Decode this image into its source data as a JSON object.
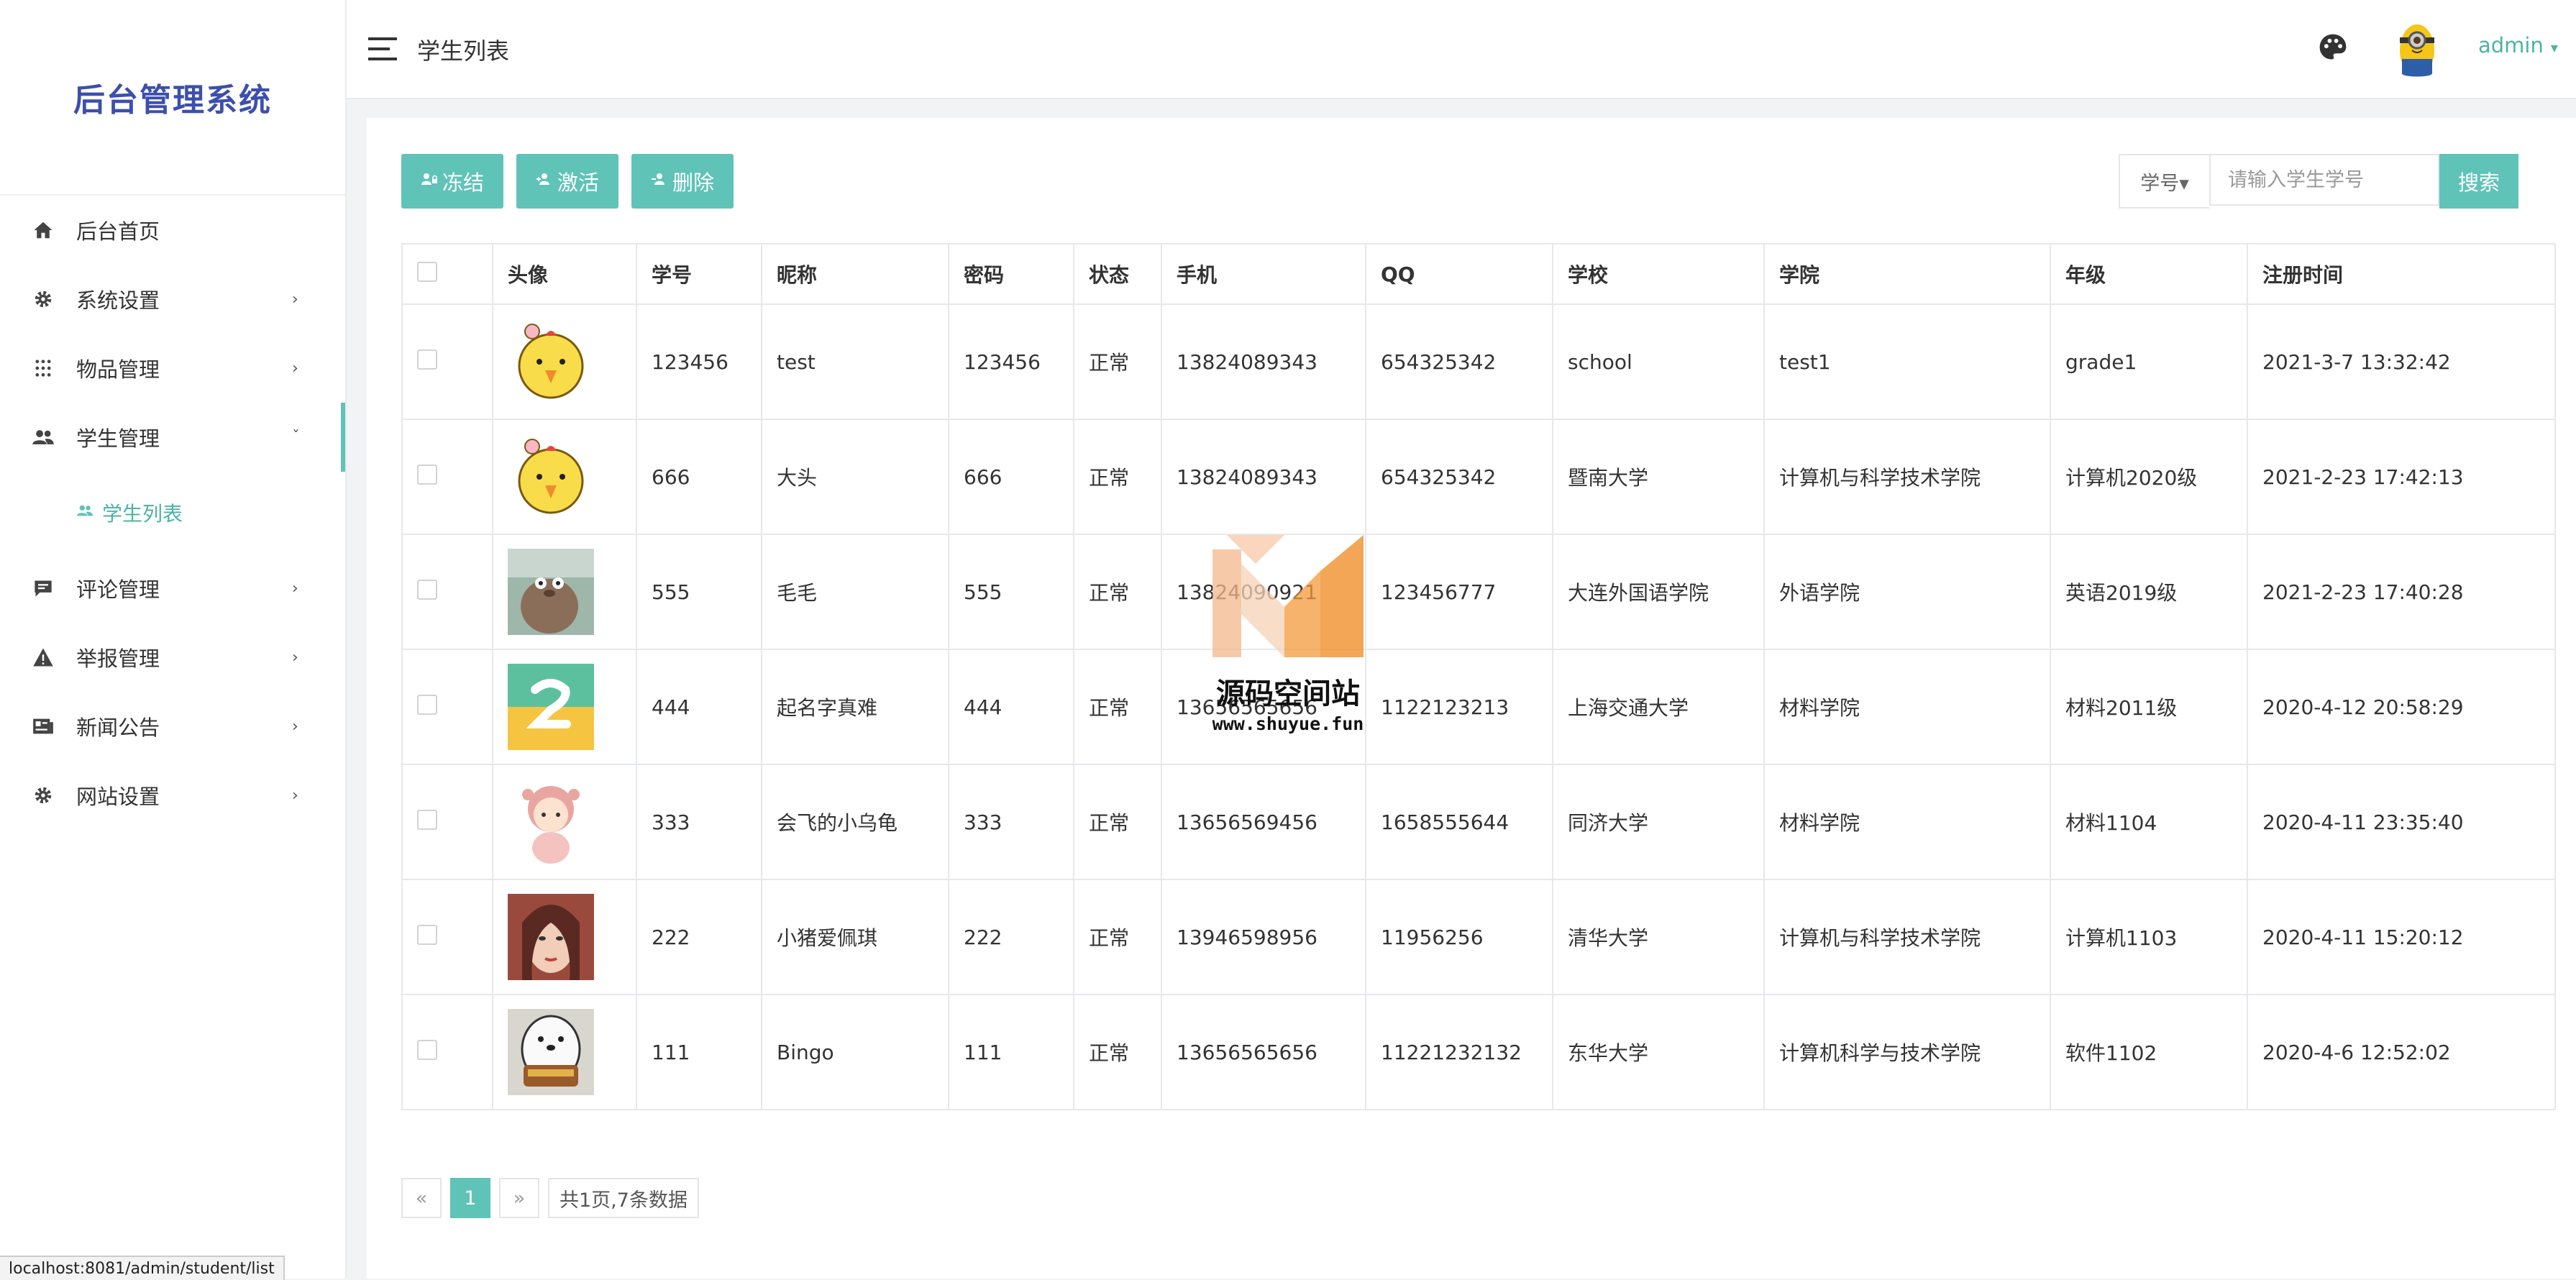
{
  "app_title": "后台管理系统",
  "sidebar": {
    "items": [
      {
        "icon": "home-icon",
        "label": "后台首页",
        "arrow": ""
      },
      {
        "icon": "gear-icon",
        "label": "系统设置",
        "arrow": "›"
      },
      {
        "icon": "grid-icon",
        "label": "物品管理",
        "arrow": "›"
      },
      {
        "icon": "users-icon",
        "label": "学生管理",
        "arrow": "ˇ"
      },
      {
        "icon": "comment-icon",
        "label": "评论管理",
        "arrow": "›"
      },
      {
        "icon": "warning-icon",
        "label": "举报管理",
        "arrow": "›"
      },
      {
        "icon": "news-icon",
        "label": "新闻公告",
        "arrow": "›"
      },
      {
        "icon": "gear-icon",
        "label": "网站设置",
        "arrow": "›"
      }
    ],
    "sub_item": {
      "icon": "users-icon",
      "label": "学生列表"
    }
  },
  "header": {
    "title": "学生列表",
    "user": "admin",
    "user_caret": "▾"
  },
  "toolbar": {
    "freeze": "冻结",
    "activate": "激活",
    "delete": "删除",
    "search_type": "学号▾",
    "search_placeholder": "请输入学生学号",
    "search_button": "搜索"
  },
  "table": {
    "columns": [
      "头像",
      "学号",
      "昵称",
      "密码",
      "状态",
      "手机",
      "QQ",
      "学校",
      "学院",
      "年级",
      "注册时间"
    ],
    "rows": [
      {
        "avatar": "chick-avatar",
        "id": "123456",
        "nickname": "test",
        "password": "123456",
        "status": "正常",
        "phone": "13824089343",
        "qq": "654325342",
        "school": "school",
        "college": "test1",
        "grade": "grade1",
        "time": "2021-3-7 13:32:42"
      },
      {
        "avatar": "chick-avatar",
        "id": "666",
        "nickname": "大头",
        "password": "666",
        "status": "正常",
        "phone": "13824089343",
        "qq": "654325342",
        "school": "暨南大学",
        "college": "计算机与科学技术学院",
        "grade": "计算机2020级",
        "time": "2021-2-23 17:42:13"
      },
      {
        "avatar": "cartoon-avatar",
        "id": "555",
        "nickname": "毛毛",
        "password": "555",
        "status": "正常",
        "phone": "13824090921",
        "qq": "123456777",
        "school": "大连外国语学院",
        "college": "外语学院",
        "grade": "英语2019级",
        "time": "2021-2-23 17:40:28"
      },
      {
        "avatar": "letter-avatar",
        "id": "444",
        "nickname": "起名字真难",
        "password": "444",
        "status": "正常",
        "phone": "13656565656",
        "qq": "1122123213",
        "school": "上海交通大学",
        "college": "材料学院",
        "grade": "材料2011级",
        "time": "2020-4-12 20:58:29"
      },
      {
        "avatar": "girl-cartoon-avatar",
        "id": "333",
        "nickname": "会飞的小乌龟",
        "password": "333",
        "status": "正常",
        "phone": "13656569456",
        "qq": "1658555644",
        "school": "同济大学",
        "college": "材料学院",
        "grade": "材料1104",
        "time": "2020-4-11 23:35:40"
      },
      {
        "avatar": "photo-avatar",
        "id": "222",
        "nickname": "小猪爱佩琪",
        "password": "222",
        "status": "正常",
        "phone": "13946598956",
        "qq": "11956256",
        "school": "清华大学",
        "college": "计算机与科学技术学院",
        "grade": "计算机1103",
        "time": "2020-4-11 15:20:12"
      },
      {
        "avatar": "bear-avatar",
        "id": "111",
        "nickname": "Bingo",
        "password": "111",
        "status": "正常",
        "phone": "13656565656",
        "qq": "11221232132",
        "school": "东华大学",
        "college": "计算机科学与技术学院",
        "grade": "软件1102",
        "time": "2020-4-6 12:52:02"
      }
    ]
  },
  "pagination": {
    "prev": "«",
    "current": "1",
    "next": "»",
    "info": "共1页,7条数据"
  },
  "watermark": {
    "text": "源码空间站",
    "url": "www.shuyue.fun"
  },
  "statusbar": "localhost:8081/admin/student/list",
  "colors": {
    "accent": "#5fc3b8",
    "status_green": "#43a97a",
    "logo": "#3c4fad"
  }
}
